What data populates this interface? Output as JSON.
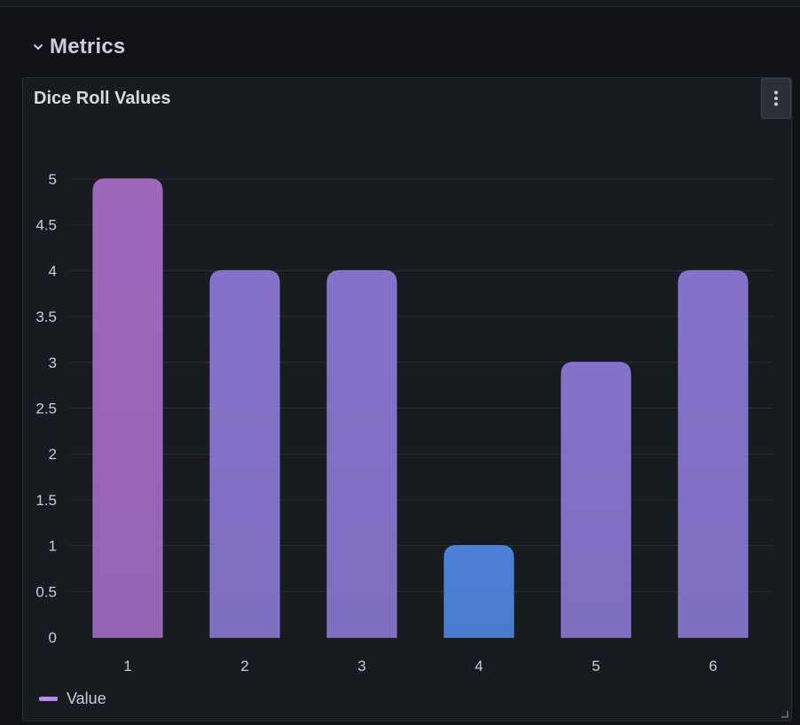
{
  "row": {
    "title": "Metrics",
    "collapse_icon": "chevron-down-icon"
  },
  "panel": {
    "title": "Dice Roll Values",
    "menu_icon": "vertical-dots-icon"
  },
  "legend": {
    "label": "Value",
    "color": "#b88be8"
  },
  "colors": {
    "low": "#4c7fd6",
    "mid": "#8371c8",
    "high": "#9d66ba",
    "grid": "#2a2d33",
    "background": "#181b1f"
  },
  "chart_data": {
    "type": "bar",
    "categories": [
      "1",
      "2",
      "3",
      "4",
      "5",
      "6"
    ],
    "values": [
      5,
      4,
      4,
      1,
      3,
      4
    ],
    "title": "Dice Roll Values",
    "xlabel": "",
    "ylabel": "",
    "ylim": [
      0,
      5
    ],
    "yticks": [
      "0",
      "0.5",
      "1",
      "1.5",
      "2",
      "2.5",
      "3",
      "3.5",
      "4",
      "4.5",
      "5"
    ],
    "grid": true,
    "legend_placement": "bottom-left",
    "series": [
      {
        "name": "Value",
        "values": [
          5,
          4,
          4,
          1,
          3,
          4
        ]
      }
    ]
  }
}
